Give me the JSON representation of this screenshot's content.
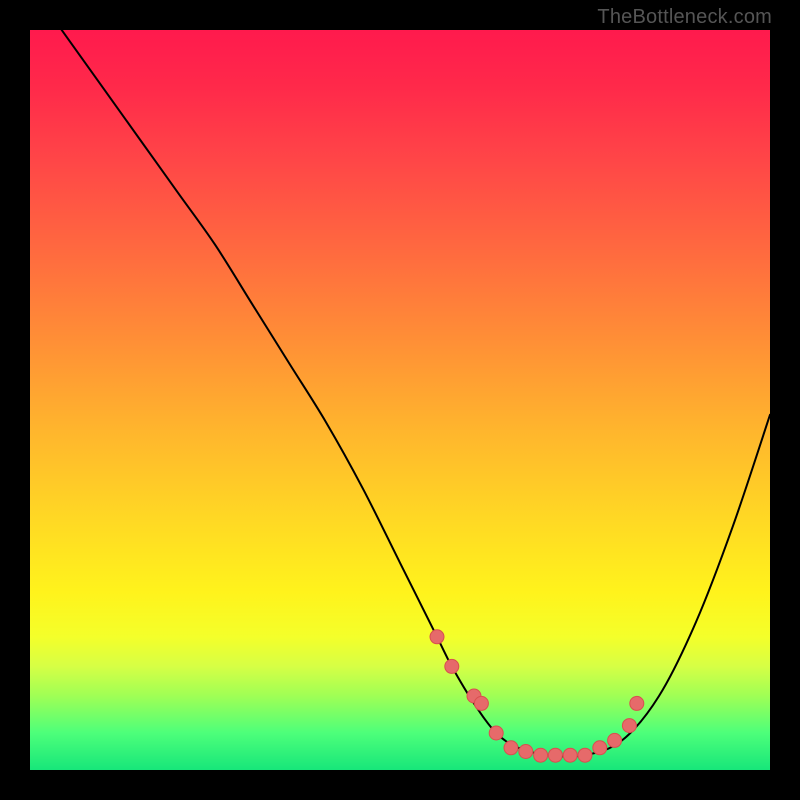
{
  "attribution": "TheBottleneck.com",
  "chart_data": {
    "type": "line",
    "title": "",
    "xlabel": "",
    "ylabel": "",
    "xlim": [
      0,
      100
    ],
    "ylim": [
      0,
      100
    ],
    "series": [
      {
        "name": "bottleneck-curve",
        "x": [
          0,
          5,
          10,
          15,
          20,
          25,
          30,
          35,
          40,
          45,
          50,
          55,
          57,
          60,
          63,
          66,
          70,
          75,
          80,
          85,
          90,
          95,
          100
        ],
        "values": [
          106,
          99,
          92,
          85,
          78,
          71,
          63,
          55,
          47,
          38,
          28,
          18,
          14,
          9,
          5,
          3,
          2,
          2,
          4,
          10,
          20,
          33,
          48
        ]
      }
    ],
    "markers": {
      "name": "highlight-points",
      "x": [
        55,
        57,
        60,
        61,
        63,
        65,
        67,
        69,
        71,
        73,
        75,
        77,
        79,
        81,
        82
      ],
      "values": [
        18,
        14,
        10,
        9,
        5,
        3,
        2.5,
        2,
        2,
        2,
        2,
        3,
        4,
        6,
        9
      ]
    },
    "colors": {
      "curve": "#000000",
      "marker_fill": "#e66a6a",
      "marker_stroke": "#d94f4f"
    }
  }
}
